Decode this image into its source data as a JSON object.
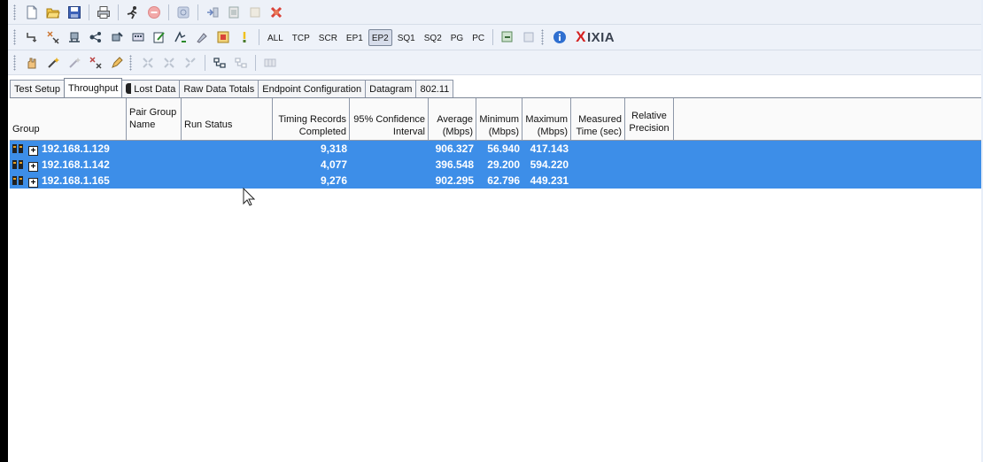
{
  "toolbar2": {
    "filters": [
      "ALL",
      "TCP",
      "SCR",
      "EP1",
      "EP2",
      "SQ1",
      "SQ2",
      "PG",
      "PC"
    ],
    "active_filter": "EP2",
    "logo_mark": "X",
    "logo_text": "IXIA"
  },
  "icons": {
    "toolbar1": [
      "new-file-icon",
      "open-folder-icon",
      "save-icon",
      "print-icon",
      "run-icon",
      "stop-icon",
      "refresh-icon",
      "copy-icon",
      "paste-icon",
      "blank-icon",
      "delete-icon"
    ],
    "toolbar2": [
      "link-icon",
      "pair-icon",
      "endpoint-icon",
      "network-icon",
      "edit-pair-icon",
      "multicast-icon",
      "notes-icon",
      "script-icon",
      "tools-icon",
      "flag-icon",
      "lightbulb-icon",
      "export-icon",
      "window-icon",
      "info-icon"
    ],
    "toolbar3": [
      "hand-icon",
      "wand-icon",
      "wand-grey-icon",
      "cluster-icon",
      "pencil-icon",
      "expand-icon",
      "collapse-icon",
      "select-icon",
      "tree-icon",
      "tree-grey-icon",
      "grid-icon"
    ]
  },
  "tabs": [
    {
      "label": "Test Setup"
    },
    {
      "label": "Throughput"
    },
    {
      "label": "Lost Data"
    },
    {
      "label": "Raw Data Totals"
    },
    {
      "label": "Endpoint Configuration"
    },
    {
      "label": "Datagram"
    },
    {
      "label": "802.11"
    }
  ],
  "selected_tab": "Throughput",
  "table": {
    "columns": [
      {
        "label": "Group"
      },
      {
        "label": "Pair Group Name"
      },
      {
        "label": "Run Status"
      },
      {
        "label": "Timing Records Completed"
      },
      {
        "label": "95% Confidence Interval"
      },
      {
        "label": "Average (Mbps)"
      },
      {
        "label": "Minimum (Mbps)"
      },
      {
        "label": "Maximum (Mbps)"
      },
      {
        "label": "Measured Time (sec)"
      },
      {
        "label": "Relative Precision"
      }
    ],
    "header_lines": [
      [
        "Group"
      ],
      [
        "Pair Group",
        "Name"
      ],
      [
        "Run Status"
      ],
      [
        "Timing Records",
        "Completed"
      ],
      [
        "95% Confidence",
        "Interval"
      ],
      [
        "Average",
        "(Mbps)"
      ],
      [
        "Minimum",
        "(Mbps)"
      ],
      [
        "Maximum",
        "(Mbps)"
      ],
      [
        "Measured",
        "Time (sec)"
      ],
      [
        "Relative",
        "Precision"
      ]
    ],
    "rows": [
      {
        "group": "192.168.1.129",
        "pair_group_name": "",
        "run_status": "",
        "timing_records": "9,318",
        "confidence": "",
        "average": "906.327",
        "minimum": "56.940",
        "maximum": "417.143",
        "measured_time": "",
        "relative_precision": ""
      },
      {
        "group": "192.168.1.142",
        "pair_group_name": "",
        "run_status": "",
        "timing_records": "4,077",
        "confidence": "",
        "average": "396.548",
        "minimum": "29.200",
        "maximum": "594.220",
        "measured_time": "",
        "relative_precision": ""
      },
      {
        "group": "192.168.1.165",
        "pair_group_name": "",
        "run_status": "",
        "timing_records": "9,276",
        "confidence": "",
        "average": "902.295",
        "minimum": "62.796",
        "maximum": "449.231",
        "measured_time": "",
        "relative_precision": ""
      }
    ],
    "selection_color": "#3d8ee8",
    "expand_glyph": "+"
  }
}
